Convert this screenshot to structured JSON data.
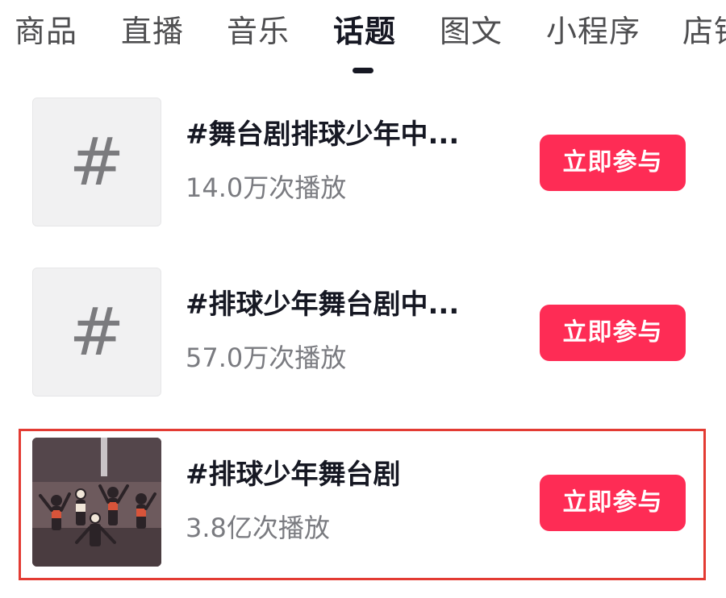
{
  "tabs": [
    {
      "label": "商品",
      "active": false
    },
    {
      "label": "直播",
      "active": false
    },
    {
      "label": "音乐",
      "active": false
    },
    {
      "label": "话题",
      "active": true
    },
    {
      "label": "图文",
      "active": false
    },
    {
      "label": "小程序",
      "active": false
    },
    {
      "label": "店铺",
      "active": false
    }
  ],
  "topics": [
    {
      "title": "#舞台剧排球少年中...",
      "plays": "14.0万次播放",
      "button": "立即参与",
      "thumb": "hash-icon"
    },
    {
      "title": "#排球少年舞台剧中...",
      "plays": "57.0万次播放",
      "button": "立即参与",
      "thumb": "hash-icon"
    },
    {
      "title": "#排球少年舞台剧",
      "plays": "3.8亿次播放",
      "button": "立即参与",
      "thumb": "stage-photo"
    }
  ],
  "thumb_glyph": "#",
  "colors": {
    "accent": "#fe2c55",
    "highlight": "#e33b33",
    "text_primary": "#161823",
    "text_secondary": "#7a7b80"
  }
}
